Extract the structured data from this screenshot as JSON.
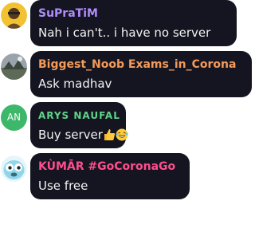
{
  "messages": [
    {
      "sender": "SuPraTiM",
      "text": "Nah i can't.. i have no server",
      "name_color": "#b18cff",
      "avatar_icon": "user-photo-avatar"
    },
    {
      "sender": "Biggest_Noob Exams_in_Corona",
      "text": "Ask madhav",
      "name_color": "#f39a5a",
      "avatar_icon": "user-photo-avatar"
    },
    {
      "sender": "ARYS NAUFAL",
      "text": "Buy server",
      "emoji": [
        "thumbs-up-emoji",
        "laughing-emoji"
      ],
      "name_color": "#5fd38a",
      "avatar_initials": "AN",
      "avatar_color": "#3db86b"
    },
    {
      "sender": "KÙMĀR #GoCoronaGo",
      "text": "Use free",
      "name_color": "#ff4d8d",
      "avatar_icon": "cartoon-face-avatar"
    }
  ]
}
